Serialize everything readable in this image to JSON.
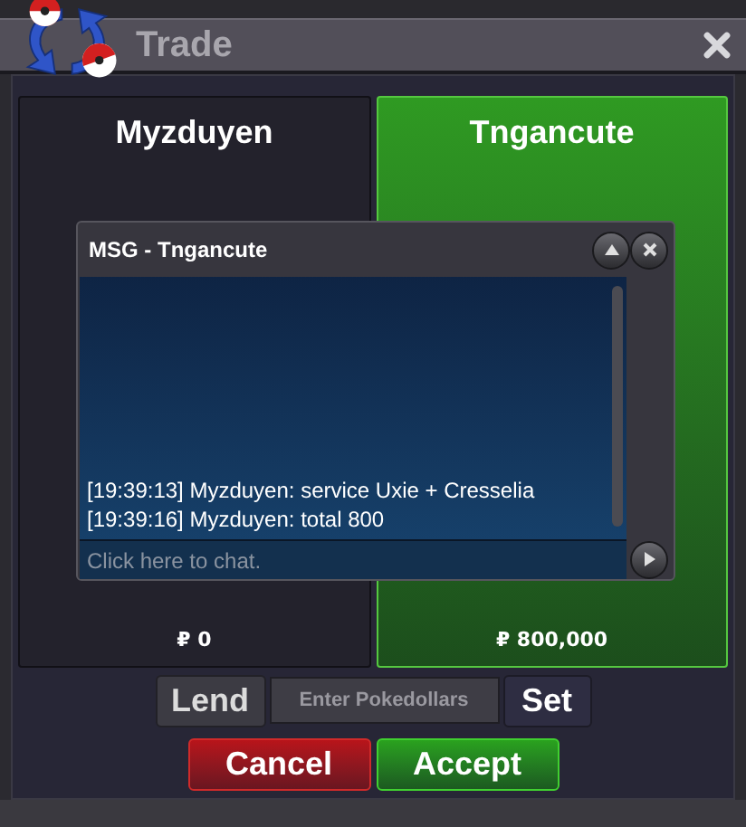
{
  "window": {
    "title": "Trade"
  },
  "traders": [
    {
      "name": "Myzduyen",
      "amount": "₽ 0",
      "ready": false
    },
    {
      "name": "Tngancute",
      "amount": "₽ 800,000",
      "ready": true
    }
  ],
  "chat": {
    "title": "MSG - Tngancute",
    "messages": [
      "[19:39:13] Myzduyen: service Uxie + Cresselia",
      "[19:39:16] Myzduyen: total 800"
    ],
    "placeholder": "Click here to chat."
  },
  "money": {
    "lend_button": "Lend",
    "placeholder": "Enter Pokedollars",
    "set_button": "Set"
  },
  "actions": [
    {
      "label": "Cancel",
      "kind": "cancel"
    },
    {
      "label": "Accept",
      "kind": "accept"
    }
  ]
}
